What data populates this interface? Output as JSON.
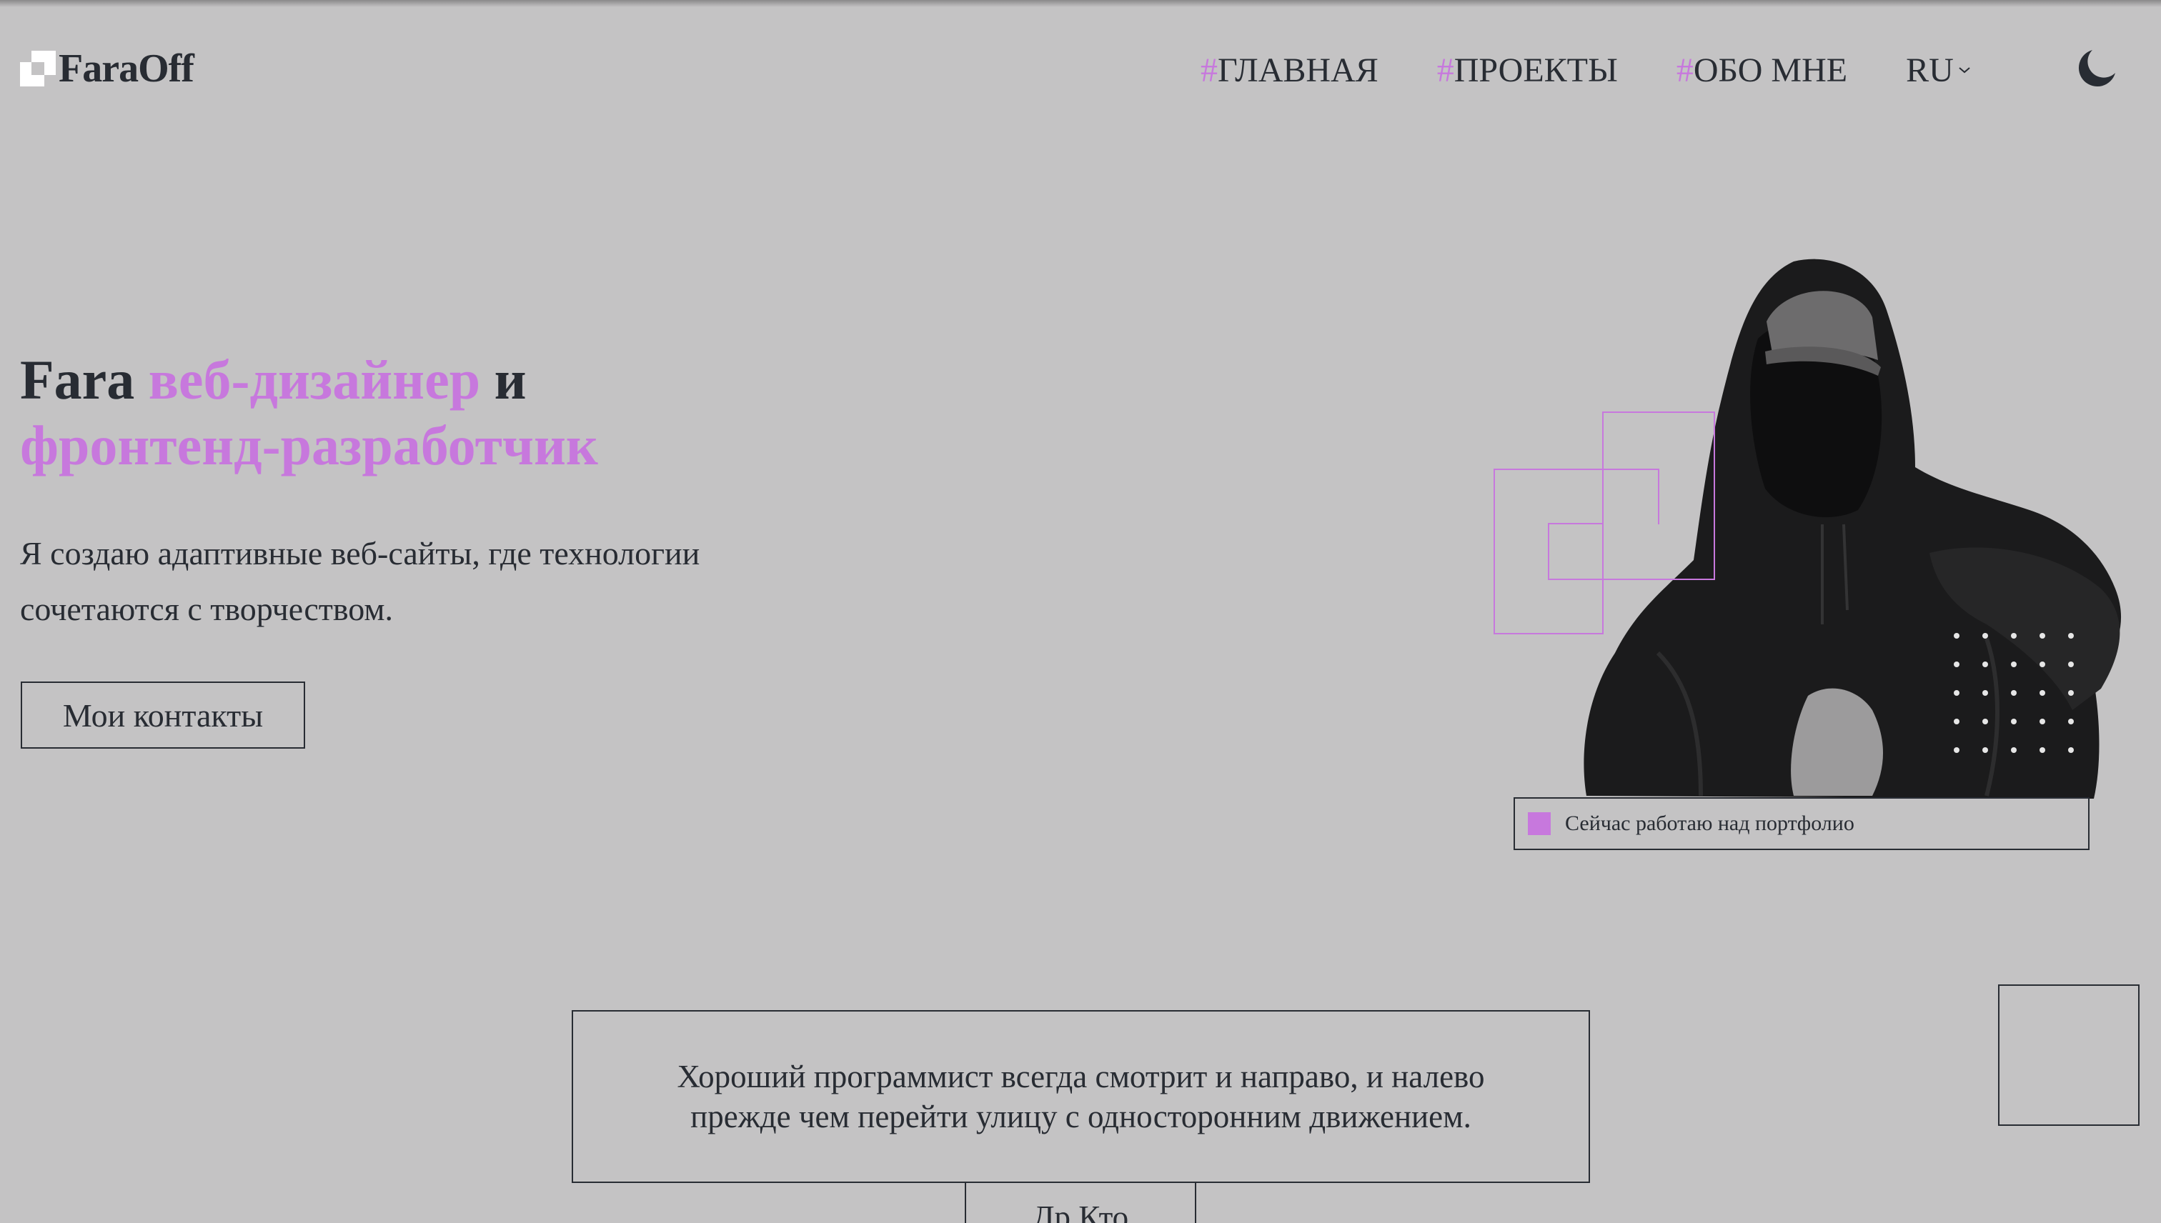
{
  "header": {
    "logo_text": "FaraOff",
    "nav": [
      {
        "hash": "#",
        "label": "ГЛАВНАЯ"
      },
      {
        "hash": "#",
        "label": "ПРОЕКТЫ"
      },
      {
        "hash": "#",
        "label": "ОБО МНЕ"
      }
    ],
    "language": "RU",
    "theme_icon": "moon-icon"
  },
  "hero": {
    "title_name": "Fara",
    "title_role1": "веб-дизайнер",
    "title_and": "и",
    "title_role2": "фронтенд-разработчик",
    "description": "Я создаю адаптивные веб-сайты, где технологии сочетаются с творчеством.",
    "contact_button": "Мои контакты",
    "status": "Сейчас работаю над портфолио"
  },
  "quote": {
    "text": "Хороший программист всегда смотрит и направо, и налево прежде чем перейти улицу с односторонним движением.",
    "author": "Др.Кто"
  },
  "colors": {
    "background": "#c4c3c4",
    "accent": "#c778dd",
    "text": "#282c33"
  }
}
